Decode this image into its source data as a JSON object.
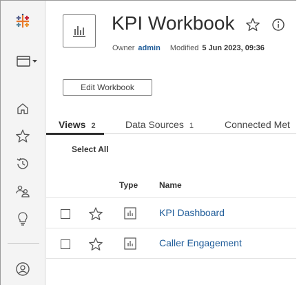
{
  "workbook": {
    "title": "KPI Workbook",
    "owner_label": "Owner",
    "owner_name": "admin",
    "modified_label": "Modified",
    "modified_value": "5 Jun 2023, 09:36",
    "edit_button_label": "Edit Workbook"
  },
  "tabs": [
    {
      "label": "Views",
      "count": "2",
      "active": true
    },
    {
      "label": "Data Sources",
      "count": "1",
      "active": false
    },
    {
      "label": "Connected Met",
      "count": "",
      "active": false
    }
  ],
  "list": {
    "select_all_label": "Select All",
    "columns": {
      "type": "Type",
      "name": "Name"
    },
    "rows": [
      {
        "name": "KPI Dashboard",
        "type_icon": "view-chart-icon"
      },
      {
        "name": "Caller Engagement",
        "type_icon": "view-chart-icon"
      }
    ]
  },
  "sidebar": {
    "icons": [
      "tableau-logo-icon",
      "site-switcher-icon",
      "home-icon",
      "favorites-star-icon",
      "recents-clock-icon",
      "groups-icon",
      "recommendations-lightbulb-icon",
      "user-profile-icon"
    ]
  },
  "colors": {
    "link": "#1f5c99",
    "sidebar_bg": "#f4f4f4"
  }
}
